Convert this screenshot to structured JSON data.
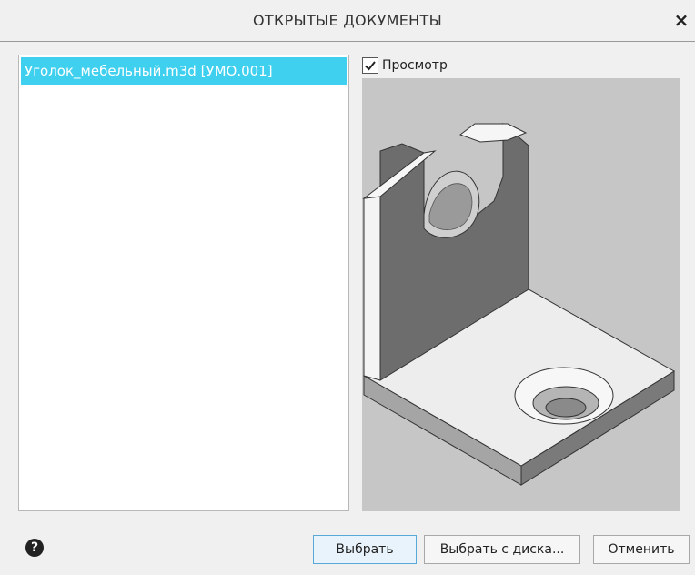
{
  "dialog": {
    "title": "ОТКРЫТЫЕ ДОКУМЕНТЫ",
    "close_glyph": "×"
  },
  "documents": {
    "items": [
      {
        "label": "Уголок_мебельный.m3d [УМО.001]",
        "selected": true
      }
    ]
  },
  "preview": {
    "checkbox_label": "Просмотр",
    "checked": true
  },
  "footer": {
    "help_glyph": "?",
    "select_label": "Выбрать",
    "select_from_disk_label": "Выбрать с диска...",
    "cancel_label": "Отменить"
  },
  "colors": {
    "selection": "#3fd0ef",
    "preview_background": "#c6c6c6"
  },
  "icons": {
    "close": "close-icon",
    "help": "help-icon",
    "check": "checkmark-icon"
  }
}
